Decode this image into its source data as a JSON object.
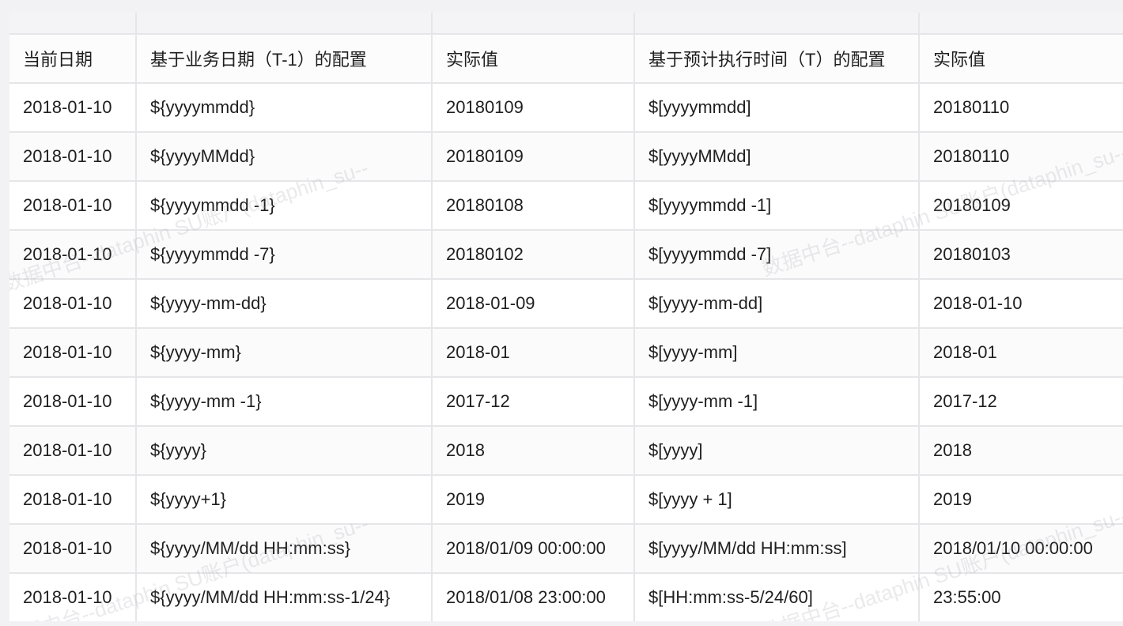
{
  "table": {
    "headers": [
      "当前日期",
      "基于业务日期（T-1）的配置",
      "实际值",
      "基于预计执行时间（T）的配置",
      "实际值"
    ],
    "rows": [
      [
        "2018-01-10",
        "${yyyymmdd}",
        "20180109",
        "$[yyyymmdd]",
        "20180110"
      ],
      [
        "2018-01-10",
        "${yyyyMMdd}",
        "20180109",
        "$[yyyyMMdd]",
        "20180110"
      ],
      [
        "2018-01-10",
        "${yyyymmdd -1}",
        "20180108",
        "$[yyyymmdd -1]",
        "20180109"
      ],
      [
        "2018-01-10",
        "${yyyymmdd -7}",
        "20180102",
        "$[yyyymmdd -7]",
        "20180103"
      ],
      [
        "2018-01-10",
        "${yyyy-mm-dd}",
        "2018-01-09",
        "$[yyyy-mm-dd]",
        "2018-01-10"
      ],
      [
        "2018-01-10",
        "${yyyy-mm}",
        "2018-01",
        "$[yyyy-mm]",
        "2018-01"
      ],
      [
        "2018-01-10",
        "${yyyy-mm -1}",
        "2017-12",
        "$[yyyy-mm -1]",
        "2017-12"
      ],
      [
        "2018-01-10",
        "${yyyy}",
        "2018",
        "$[yyyy]",
        "2018"
      ],
      [
        "2018-01-10",
        "${yyyy+1}",
        "2019",
        "$[yyyy + 1]",
        "2019"
      ],
      [
        "2018-01-10",
        "${yyyy/MM/dd HH:mm:ss}",
        "2018/01/09 00:00:00",
        "$[yyyy/MM/dd HH:mm:ss]",
        "2018/01/10 00:00:00"
      ],
      [
        "2018-01-10",
        "${yyyy/MM/dd HH:mm:ss-1/24}",
        "2018/01/08 23:00:00",
        "$[HH:mm:ss-5/24/60]",
        "23:55:00"
      ]
    ]
  },
  "watermark": {
    "text": "数据中台--dataphin SU账户(dataphin_su--"
  }
}
